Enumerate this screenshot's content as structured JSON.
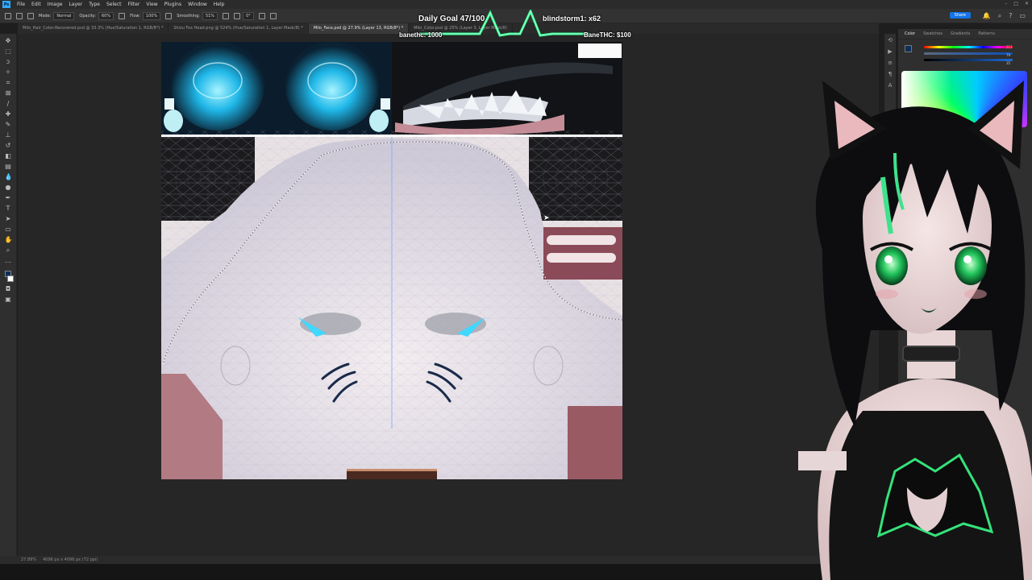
{
  "menubar": {
    "logo": "Ps",
    "items": [
      "File",
      "Edit",
      "Image",
      "Layer",
      "Type",
      "Select",
      "Filter",
      "View",
      "Plugins",
      "Window",
      "Help"
    ]
  },
  "options": {
    "mode_label": "Mode:",
    "mode_value": "Normal",
    "opacity_label": "Opacity:",
    "opacity_value": "60%",
    "flow_label": "Flow:",
    "flow_value": "100%",
    "smoothing_label": "Smoothing:",
    "smoothing_value": "51%",
    "angle_value": "0°",
    "share_label": "Share"
  },
  "tabs": [
    {
      "label": "Milo_Hair_Color-Recovered.psd @ 33.3% (Hue/Saturation 1, RGB/8*) *",
      "active": false
    },
    {
      "label": "Shizu Fox Head.png @ 524% (Hue/Saturation 1, Layer Mask/8) *",
      "active": false
    },
    {
      "label": "Milo_Face.psd @ 27.9% (Layer 13, RGB/8*) *",
      "active": true
    },
    {
      "label": "Milo_Color.psd @ 25% (Layer 3, Layer Mask/8)",
      "active": false
    }
  ],
  "panel": {
    "tabs": [
      "Color",
      "Swatches",
      "Gradients",
      "Patterns"
    ],
    "values": [
      "212",
      "79",
      "35"
    ]
  },
  "status": {
    "zoom": "27.89%",
    "doc_info": "4096 px x 4096 px (72 ppi)"
  },
  "overlay": {
    "goal": "Daily Goal 47/100",
    "bits": "blindstorm1: x62",
    "cheer": "banethc: 1000",
    "tip": "BaneTHC: $100"
  },
  "colors": {
    "accent": "#31a8ff",
    "share": "#1473e6",
    "goal_wave": "#2bff8f",
    "foreground": "#0d2f5a"
  }
}
